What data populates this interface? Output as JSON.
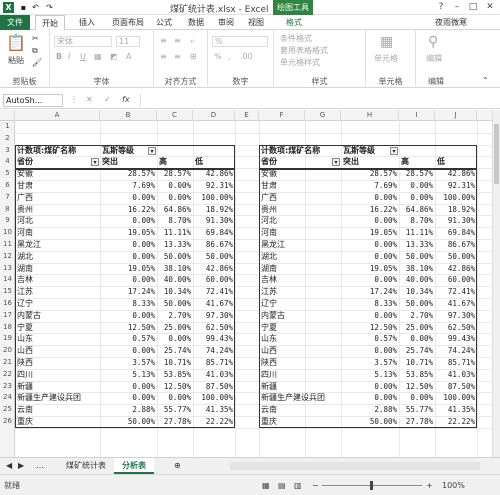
{
  "window": {
    "title": "煤矿统计表.xlsx - Excel",
    "context_tab_title": "绘图工具",
    "minimize": "?",
    "restore": "□",
    "close": "✕",
    "help": "?"
  },
  "tabs": [
    "文件",
    "开始",
    "插入",
    "页面布局",
    "公式",
    "数据",
    "审阅",
    "视图",
    "格式"
  ],
  "user": "夜雨微寒",
  "ribbon": {
    "clipboard": "剪贴板",
    "paste": "粘贴",
    "font": "字体",
    "font_name": "宋体",
    "font_size": "11",
    "align": "对齐方式",
    "number": "数字",
    "number_format": "%",
    "styles": "样式",
    "cond_format": "条件格式",
    "table_format": "套用表格格式",
    "cell_styles": "单元格样式",
    "cells": "单元格",
    "cells_btn": "单元格",
    "editing": "编辑",
    "editing_btn": "编辑"
  },
  "formula_bar": {
    "name_box": "AutoSh...",
    "fx": "fx"
  },
  "columns_left": [
    "A",
    "B",
    "C",
    "D",
    "E"
  ],
  "columns_right": [
    "F",
    "G",
    "H",
    "I",
    "J"
  ],
  "rows": [
    "1",
    "2",
    "3",
    "4",
    "5",
    "6",
    "7",
    "8",
    "9",
    "10",
    "11",
    "12",
    "13",
    "14",
    "15",
    "16",
    "17",
    "18",
    "19",
    "20",
    "21",
    "22",
    "23",
    "24",
    "25",
    "26"
  ],
  "pivot": {
    "title": "计数项:煤矿名称",
    "col_field": "瓦斯等级",
    "row_field": "省份",
    "col1": "突出",
    "col2": "高",
    "col3": "低",
    "rows": [
      [
        "安徽",
        "28.57%",
        "28.57%",
        "42.86%"
      ],
      [
        "甘肃",
        "7.69%",
        "0.00%",
        "92.31%"
      ],
      [
        "广西",
        "0.00%",
        "0.00%",
        "100.00%"
      ],
      [
        "贵州",
        "16.22%",
        "64.86%",
        "18.92%"
      ],
      [
        "河北",
        "0.00%",
        "8.70%",
        "91.30%"
      ],
      [
        "河南",
        "19.05%",
        "11.11%",
        "69.84%"
      ],
      [
        "黑龙江",
        "0.00%",
        "13.33%",
        "86.67%"
      ],
      [
        "湖北",
        "0.00%",
        "50.00%",
        "50.00%"
      ],
      [
        "湖南",
        "19.05%",
        "38.10%",
        "42.86%"
      ],
      [
        "吉林",
        "0.00%",
        "40.00%",
        "60.00%"
      ],
      [
        "江苏",
        "17.24%",
        "10.34%",
        "72.41%"
      ],
      [
        "辽宁",
        "8.33%",
        "50.00%",
        "41.67%"
      ],
      [
        "内蒙古",
        "0.00%",
        "2.70%",
        "97.30%"
      ],
      [
        "宁夏",
        "12.50%",
        "25.00%",
        "62.50%"
      ],
      [
        "山东",
        "0.57%",
        "0.00%",
        "99.43%"
      ],
      [
        "山西",
        "0.00%",
        "25.74%",
        "74.24%"
      ],
      [
        "陕西",
        "3.57%",
        "10.71%",
        "85.71%"
      ],
      [
        "四川",
        "5.13%",
        "53.85%",
        "41.03%"
      ],
      [
        "新疆",
        "0.00%",
        "12.50%",
        "87.50%"
      ],
      [
        "新疆生产建设兵团",
        "0.00%",
        "0.00%",
        "100.00%"
      ],
      [
        "云南",
        "2.88%",
        "55.77%",
        "41.35%"
      ],
      [
        "重庆",
        "50.00%",
        "27.78%",
        "22.22%"
      ]
    ]
  },
  "sheets": [
    "煤矿统计表",
    "分析表"
  ],
  "status": {
    "ready": "就绪",
    "zoom": "100%"
  }
}
